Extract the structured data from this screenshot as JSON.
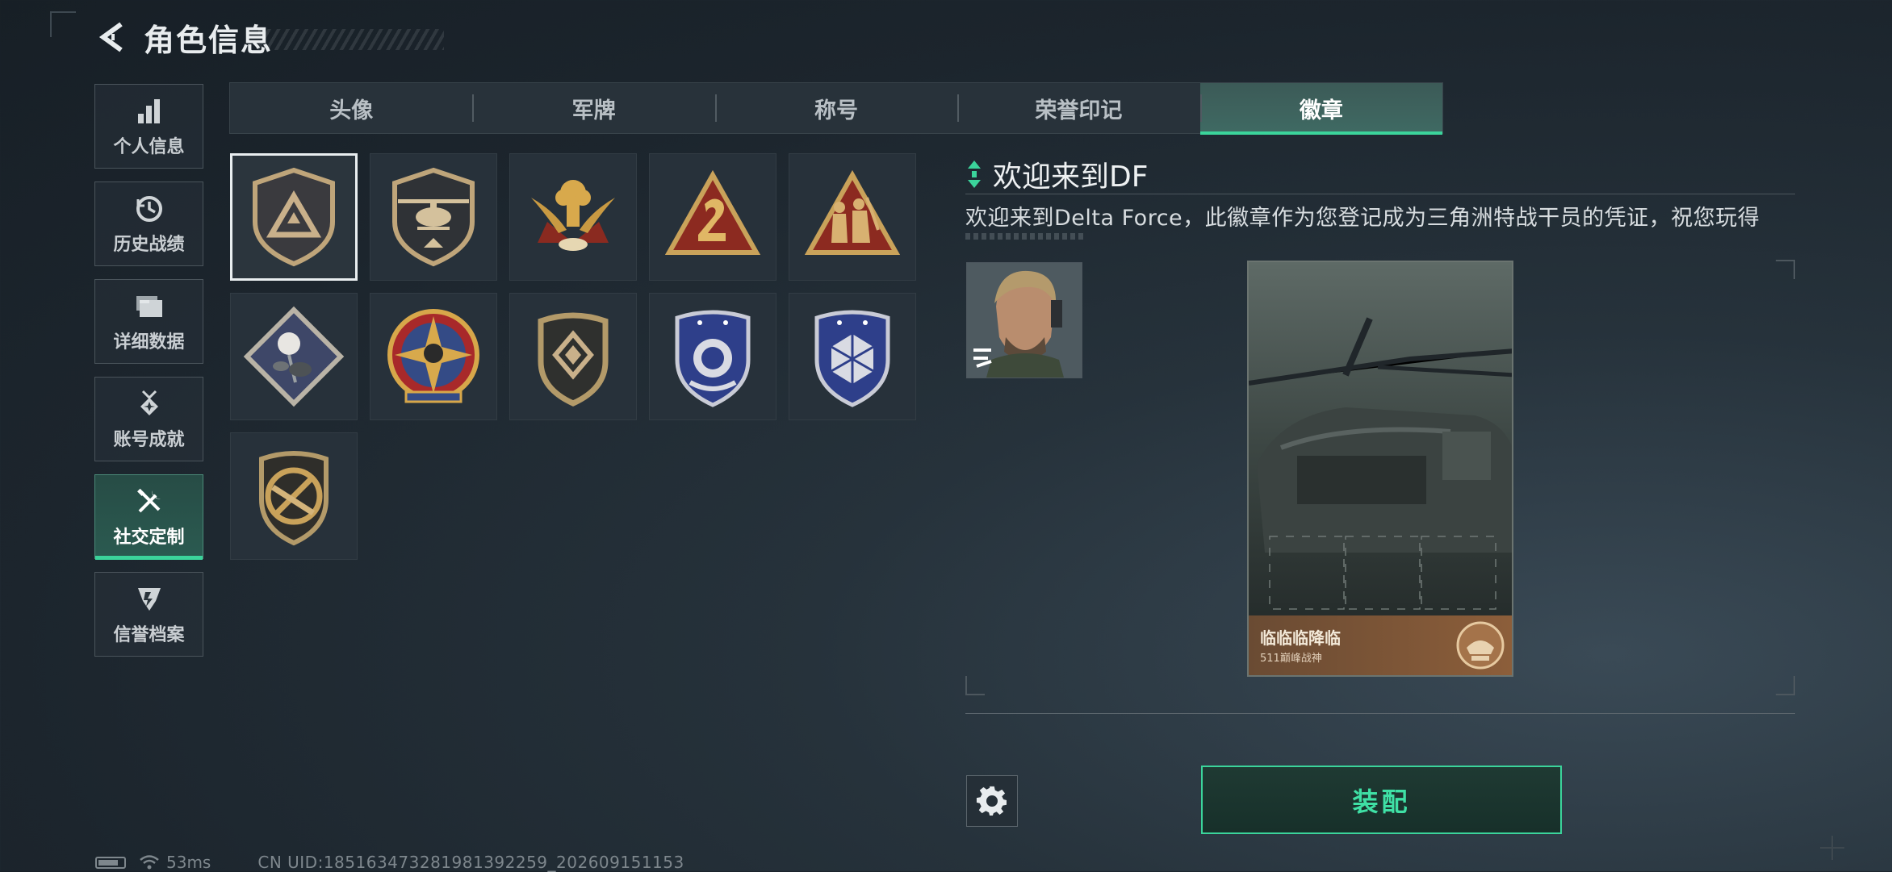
{
  "header": {
    "title": "角色信息"
  },
  "sidebar": {
    "items": [
      {
        "label": "个人信息",
        "icon": "bar-chart-icon",
        "active": false
      },
      {
        "label": "历史战绩",
        "icon": "history-clock-icon",
        "active": false
      },
      {
        "label": "详细数据",
        "icon": "folder-stack-icon",
        "active": false
      },
      {
        "label": "账号成就",
        "icon": "achievement-medal-icon",
        "active": false
      },
      {
        "label": "社交定制",
        "icon": "tools-icon",
        "active": true
      },
      {
        "label": "信誉档案",
        "icon": "credit-shield-icon",
        "active": false
      }
    ]
  },
  "tabs": [
    {
      "label": "头像",
      "active": false
    },
    {
      "label": "军牌",
      "active": false
    },
    {
      "label": "称号",
      "active": false
    },
    {
      "label": "荣誉印记",
      "active": false
    },
    {
      "label": "徽章",
      "active": true
    }
  ],
  "badges": [
    {
      "icon": "delta-triangle-badge-icon",
      "selected": true
    },
    {
      "icon": "helicopter-badge-icon"
    },
    {
      "icon": "winged-explosion-badge-icon"
    },
    {
      "icon": "number-two-triangle-badge-icon"
    },
    {
      "icon": "soldiers-triangle-badge-icon"
    },
    {
      "icon": "rose-diamond-badge-icon"
    },
    {
      "icon": "skull-star-badge-icon"
    },
    {
      "icon": "gold-shield-badge-icon"
    },
    {
      "icon": "blue-laurel-shield-badge-icon"
    },
    {
      "icon": "blue-polyhedron-shield-badge-icon"
    },
    {
      "icon": "rifle-prohibited-badge-icon"
    }
  ],
  "detail": {
    "title": "欢迎来到DF",
    "description": "欢迎来到Delta Force，此徽章作为您登记成为三角洲特战干员的凭证，祝您玩得",
    "card": {
      "name": "临临临降临",
      "subtitle": "511巅峰战神"
    }
  },
  "actions": {
    "equip_label": "装配"
  },
  "status": {
    "ping": "53ms",
    "uid": "CN UID:18516347328198139225​9_202609151153"
  },
  "colors": {
    "accent": "#3bd49b",
    "background": "#1c252d",
    "card_footer": "#8c5e3a"
  }
}
